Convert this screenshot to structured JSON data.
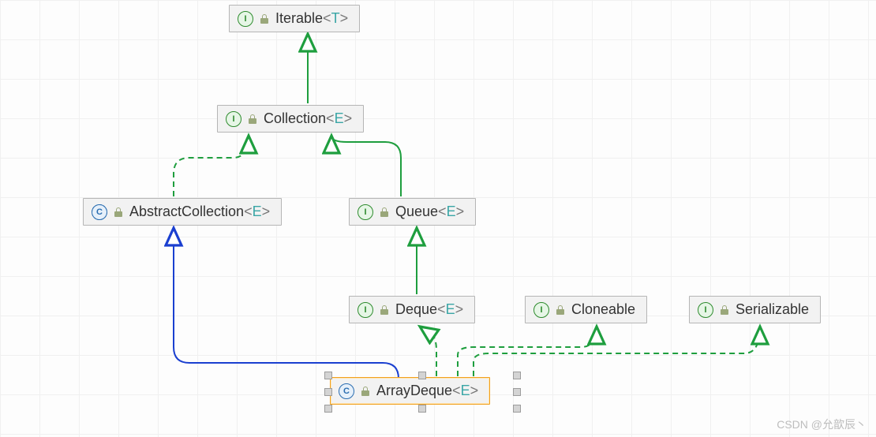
{
  "diagram": {
    "nodes": {
      "iterable": {
        "kind_letter": "I",
        "name": "Iterable",
        "generic": "T",
        "type": "interface"
      },
      "collection": {
        "kind_letter": "I",
        "name": "Collection",
        "generic": "E",
        "type": "interface"
      },
      "abstractcollection": {
        "kind_letter": "C",
        "name": "AbstractCollection",
        "generic": "E",
        "type": "abstract-class"
      },
      "queue": {
        "kind_letter": "I",
        "name": "Queue",
        "generic": "E",
        "type": "interface"
      },
      "deque": {
        "kind_letter": "I",
        "name": "Deque",
        "generic": "E",
        "type": "interface"
      },
      "cloneable": {
        "kind_letter": "I",
        "name": "Cloneable",
        "generic": "",
        "type": "interface"
      },
      "serializable": {
        "kind_letter": "I",
        "name": "Serializable",
        "generic": "",
        "type": "interface"
      },
      "arraydeque": {
        "kind_letter": "C",
        "name": "ArrayDeque",
        "generic": "E",
        "type": "class",
        "selected": true
      }
    },
    "edges": [
      {
        "from": "collection",
        "to": "iterable",
        "style": "solid-green",
        "relation": "extends-interface"
      },
      {
        "from": "abstractcollection",
        "to": "collection",
        "style": "dashed-green",
        "relation": "implements"
      },
      {
        "from": "queue",
        "to": "collection",
        "style": "solid-green",
        "relation": "extends-interface"
      },
      {
        "from": "deque",
        "to": "queue",
        "style": "solid-green",
        "relation": "extends-interface"
      },
      {
        "from": "arraydeque",
        "to": "abstractcollection",
        "style": "solid-blue",
        "relation": "extends-class"
      },
      {
        "from": "arraydeque",
        "to": "deque",
        "style": "dashed-green",
        "relation": "implements"
      },
      {
        "from": "arraydeque",
        "to": "cloneable",
        "style": "dashed-green",
        "relation": "implements"
      },
      {
        "from": "arraydeque",
        "to": "serializable",
        "style": "dashed-green",
        "relation": "implements"
      }
    ],
    "colors": {
      "green": "#1e9e3e",
      "blue": "#1a3fd0",
      "node_bg": "#f2f2f2",
      "node_border": "#b5b5b5",
      "selected_border": "#f0a020"
    }
  },
  "watermark": "CSDN @允歆辰丶"
}
